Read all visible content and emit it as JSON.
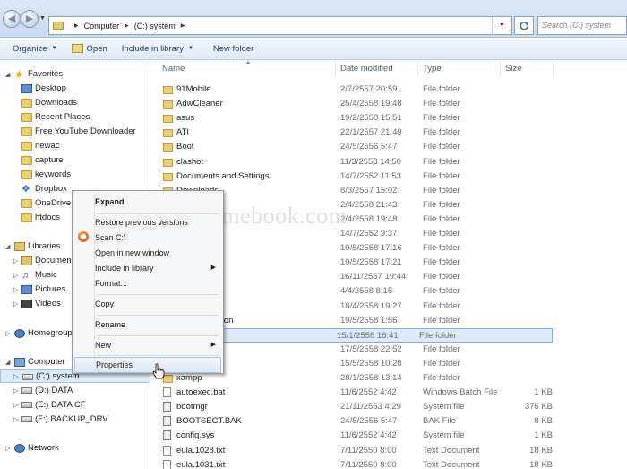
{
  "address": {
    "crumbs": [
      "Computer",
      "(C:) system"
    ],
    "search_placeholder": "Search (C:) system"
  },
  "toolbar": {
    "organize": "Organize",
    "open": "Open",
    "include_in_library": "Include in library",
    "new_folder": "New folder"
  },
  "nav": {
    "favorites": "Favorites",
    "fav_items": [
      "Desktop",
      "Downloads",
      "Recent Places",
      "Free YouTube Downloader",
      "newac",
      "capture",
      "keywords",
      "Dropbox",
      "OneDrive",
      "htdocs"
    ],
    "libraries": "Libraries",
    "lib_items": [
      "Documen",
      "Music",
      "Pictures",
      "Videos"
    ],
    "homegroup": "Homegroup",
    "computer": "Computer",
    "drives": [
      "(C:) system",
      "(D:) DATA",
      "(E:) DATA CF",
      "(F:) BACKUP_DRV"
    ],
    "network": "Network"
  },
  "columns": {
    "name": "Name",
    "date": "Date modified",
    "type": "Type",
    "size": "Size"
  },
  "files": [
    {
      "name": "91Mobile",
      "date": "2/7/2557 20:59",
      "type": "File folder",
      "size": ""
    },
    {
      "name": "AdwCleaner",
      "date": "25/4/2558 19:48",
      "type": "File folder",
      "size": ""
    },
    {
      "name": "asus",
      "date": "19/2/2558 15:51",
      "type": "File folder",
      "size": ""
    },
    {
      "name": "ATI",
      "date": "22/1/2557 21:49",
      "type": "File folder",
      "size": ""
    },
    {
      "name": "Boot",
      "date": "24/5/2556 5:47",
      "type": "File folder",
      "size": ""
    },
    {
      "name": "clashot",
      "date": "11/3/2558 14:50",
      "type": "File folder",
      "size": ""
    },
    {
      "name": "Documents and Settings",
      "date": "14/7/2552 11:53",
      "type": "File folder",
      "size": ""
    },
    {
      "name": "Downloads",
      "date": "8/3/2557 15:02",
      "type": "File folder",
      "size": ""
    },
    {
      "name": "",
      "date": "2/4/2558 21:43",
      "type": "File folder",
      "size": ""
    },
    {
      "name": "",
      "date": "2/4/2558 19:48",
      "type": "File folder",
      "size": ""
    },
    {
      "name": "",
      "date": "14/7/2552 9:37",
      "type": "File folder",
      "size": ""
    },
    {
      "name": "s",
      "date": "19/5/2558 17:16",
      "type": "File folder",
      "size": ""
    },
    {
      "name": "",
      "date": "19/5/2558 17:21",
      "type": "File folder",
      "size": ""
    },
    {
      "name": "",
      "date": "16/11/2557 19:44",
      "type": "File folder",
      "size": ""
    },
    {
      "name": "",
      "date": "4/4/2558 8:15",
      "type": "File folder",
      "size": ""
    },
    {
      "name": "",
      "date": "18/4/2558 19:27",
      "type": "File folder",
      "size": ""
    },
    {
      "name": "me Information",
      "date": "19/5/2558 1:56",
      "type": "File folder",
      "size": ""
    },
    {
      "name": "",
      "date": "15/1/2558 16:41",
      "type": "File folder",
      "size": ""
    },
    {
      "name": "g",
      "date": "17/5/2558 22:52",
      "type": "File folder",
      "size": ""
    },
    {
      "name": "",
      "date": "15/5/2558 10:28",
      "type": "File folder",
      "size": ""
    },
    {
      "name": "xampp",
      "date": "28/1/2558 13:14",
      "type": "File folder",
      "size": ""
    },
    {
      "name": "autoexec.bat",
      "date": "11/6/2552 4:42",
      "type": "Windows Batch File",
      "size": "1 KB"
    },
    {
      "name": "bootmgr",
      "date": "21/11/2553 4:29",
      "type": "System file",
      "size": "375 KB"
    },
    {
      "name": "BOOTSECT.BAK",
      "date": "24/5/2556 5:47",
      "type": "BAK File",
      "size": "8 KB"
    },
    {
      "name": "config.sys",
      "date": "11/6/2552 4:42",
      "type": "System file",
      "size": "1 KB"
    },
    {
      "name": "eula.1028.txt",
      "date": "7/11/2550 8:00",
      "type": "Text Document",
      "size": "18 KB"
    },
    {
      "name": "eula.1031.txt",
      "date": "7/11/2550 8:00",
      "type": "Text Document",
      "size": "18 KB"
    }
  ],
  "watermark": "siamebook.com",
  "context_menu": {
    "expand": "Expand",
    "restore": "Restore previous versions",
    "scan": "Scan C:\\",
    "open_new_window": "Open in new window",
    "include_in_library": "Include in library",
    "format": "Format...",
    "copy": "Copy",
    "rename": "Rename",
    "new": "New",
    "properties": "Properties"
  }
}
